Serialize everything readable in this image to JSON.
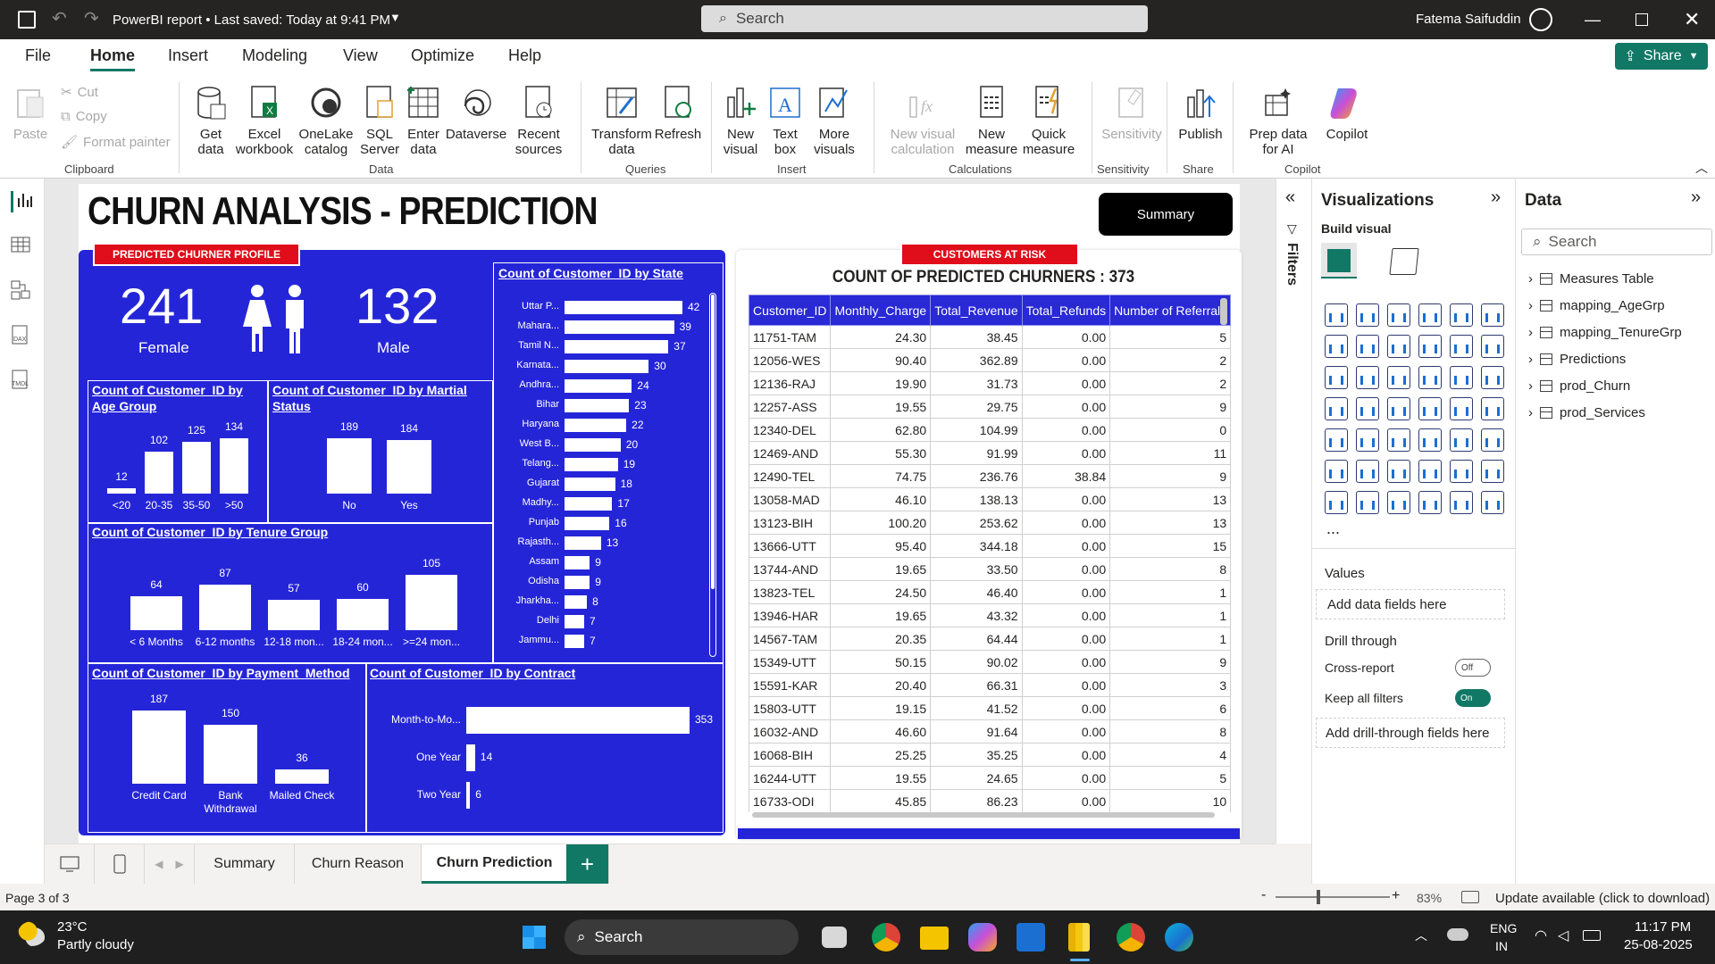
{
  "titlebar": {
    "title": "PowerBI report • Last saved: Today at 9:41 PM",
    "search": "Search",
    "user": "Fatema Saifuddin"
  },
  "menu": {
    "items": [
      "File",
      "Home",
      "Insert",
      "Modeling",
      "View",
      "Optimize",
      "Help"
    ],
    "active": "Home",
    "share": "Share"
  },
  "ribbon": {
    "clipboard": {
      "paste": "Paste",
      "cut": "Cut",
      "copy": "Copy",
      "format_painter": "Format painter",
      "group": "Clipboard"
    },
    "data": {
      "get_data": "Get data",
      "excel": "Excel workbook",
      "onelake": "OneLake catalog",
      "sql": "SQL Server",
      "enter": "Enter data",
      "dataverse": "Dataverse",
      "recent": "Recent sources",
      "group": "Data"
    },
    "queries": {
      "transform": "Transform data",
      "refresh": "Refresh",
      "group": "Queries"
    },
    "insert": {
      "new_visual": "New visual",
      "text_box": "Text box",
      "more_visuals": "More visuals",
      "group": "Insert"
    },
    "calculations": {
      "new_visual_calc": "New visual calculation",
      "new_measure": "New measure",
      "quick_measure": "Quick measure",
      "group": "Calculations"
    },
    "sensitivity": {
      "label": "Sensitivity",
      "group": "Sensitivity"
    },
    "share": {
      "publish": "Publish",
      "group": "Share"
    },
    "copilot": {
      "prep": "Prep data for AI",
      "copilot": "Copilot",
      "group": "Copilot"
    }
  },
  "report": {
    "title": "CHURN ANALYSIS - PREDICTION",
    "summary_button": "Summary",
    "profile_tag": "PREDICTED CHURNER PROFILE",
    "risk_tag": "CUSTOMERS AT RISK",
    "female_count": "241",
    "female_label": "Female",
    "male_count": "132",
    "male_label": "Male",
    "age_title": "Count of Customer_ID by Age Group",
    "marital_title": "Count of Customer_ID by Martial Status",
    "tenure_title": "Count of Customer_ID by Tenure Group",
    "payment_title": "Count of Customer_ID by Payment_Method",
    "contract_title": "Count of Customer_ID by Contract",
    "state_title": "Count of Customer_ID by State",
    "table_title": "COUNT OF PREDICTED CHURNERS : 373"
  },
  "chart_data": [
    {
      "type": "bar",
      "title": "Count of Customer_ID by Age Group",
      "categories": [
        "<20",
        "20-35",
        "35-50",
        ">50"
      ],
      "values": [
        12,
        102,
        125,
        134
      ]
    },
    {
      "type": "bar",
      "title": "Count of Customer_ID by Martial Status",
      "categories": [
        "No",
        "Yes"
      ],
      "values": [
        189,
        184
      ]
    },
    {
      "type": "bar",
      "title": "Count of Customer_ID by Tenure Group",
      "categories": [
        "< 6 Months",
        "6-12 months",
        "12-18 mon...",
        "18-24 mon...",
        ">=24 mon..."
      ],
      "values": [
        64,
        87,
        57,
        60,
        105
      ]
    },
    {
      "type": "bar",
      "title": "Count of Customer_ID by Payment_Method",
      "categories": [
        "Credit Card",
        "Bank Withdrawal",
        "Mailed Check"
      ],
      "values": [
        187,
        150,
        36
      ]
    },
    {
      "type": "bar",
      "orientation": "horizontal",
      "title": "Count of Customer_ID by Contract",
      "categories": [
        "Month-to-Mo...",
        "One Year",
        "Two Year"
      ],
      "values": [
        353,
        14,
        6
      ]
    },
    {
      "type": "bar",
      "orientation": "horizontal",
      "title": "Count of Customer_ID by State",
      "categories": [
        "Uttar P...",
        "Mahara...",
        "Tamil N...",
        "Karnata...",
        "Andhra...",
        "Bihar",
        "Haryana",
        "West B...",
        "Telang...",
        "Gujarat",
        "Madhy...",
        "Punjab",
        "Rajasth...",
        "Assam",
        "Odisha",
        "Jharkha...",
        "Delhi",
        "Jammu..."
      ],
      "values": [
        42,
        39,
        37,
        30,
        24,
        23,
        22,
        20,
        19,
        18,
        17,
        16,
        13,
        9,
        9,
        8,
        7,
        7
      ]
    }
  ],
  "table": {
    "columns": [
      "Customer_ID",
      "Monthly_Charge",
      "Total_Revenue",
      "Total_Refunds",
      "Number of Referrals"
    ],
    "rows": [
      [
        "11751-TAM",
        "24.30",
        "38.45",
        "0.00",
        "5"
      ],
      [
        "12056-WES",
        "90.40",
        "362.89",
        "0.00",
        "2"
      ],
      [
        "12136-RAJ",
        "19.90",
        "31.73",
        "0.00",
        "2"
      ],
      [
        "12257-ASS",
        "19.55",
        "29.75",
        "0.00",
        "9"
      ],
      [
        "12340-DEL",
        "62.80",
        "104.99",
        "0.00",
        "0"
      ],
      [
        "12469-AND",
        "55.30",
        "91.99",
        "0.00",
        "11"
      ],
      [
        "12490-TEL",
        "74.75",
        "236.76",
        "38.84",
        "9"
      ],
      [
        "13058-MAD",
        "46.10",
        "138.13",
        "0.00",
        "13"
      ],
      [
        "13123-BIH",
        "100.20",
        "253.62",
        "0.00",
        "13"
      ],
      [
        "13666-UTT",
        "95.40",
        "344.18",
        "0.00",
        "15"
      ],
      [
        "13744-AND",
        "19.65",
        "33.50",
        "0.00",
        "8"
      ],
      [
        "13823-TEL",
        "24.50",
        "46.40",
        "0.00",
        "1"
      ],
      [
        "13946-HAR",
        "19.65",
        "43.32",
        "0.00",
        "1"
      ],
      [
        "14567-TAM",
        "20.35",
        "64.44",
        "0.00",
        "1"
      ],
      [
        "15349-UTT",
        "50.15",
        "90.02",
        "0.00",
        "9"
      ],
      [
        "15591-KAR",
        "20.40",
        "66.31",
        "0.00",
        "3"
      ],
      [
        "15803-UTT",
        "19.15",
        "41.52",
        "0.00",
        "6"
      ],
      [
        "16032-AND",
        "46.60",
        "91.64",
        "0.00",
        "8"
      ],
      [
        "16068-BIH",
        "25.25",
        "35.25",
        "0.00",
        "4"
      ],
      [
        "16244-UTT",
        "19.55",
        "24.65",
        "0.00",
        "5"
      ],
      [
        "16733-ODI",
        "45.85",
        "86.23",
        "0.00",
        "10"
      ]
    ]
  },
  "filters": {
    "label": "Filters"
  },
  "visualizations": {
    "title": "Visualizations",
    "build": "Build visual",
    "values": "Values",
    "add_fields": "Add data fields here",
    "drill": "Drill through",
    "cross": "Cross-report",
    "cross_state": "Off",
    "keep": "Keep all filters",
    "keep_state": "On",
    "add_drill": "Add drill-through fields here",
    "more": "..."
  },
  "data_pane": {
    "title": "Data",
    "search": "Search",
    "tables": [
      "Measures Table",
      "mapping_AgeGrp",
      "mapping_TenureGrp",
      "Predictions",
      "prod_Churn",
      "prod_Services"
    ]
  },
  "tabs": {
    "items": [
      "Summary",
      "Churn Reason",
      "Churn Prediction"
    ],
    "active": "Churn Prediction",
    "add": "+"
  },
  "status": {
    "page": "Page 3 of 3",
    "zoom": "83%",
    "update": "Update available (click to download)"
  },
  "taskbar": {
    "temp": "23°C",
    "weather": "Partly cloudy",
    "search": "Search",
    "lang1": "ENG",
    "lang2": "IN",
    "time": "11:17 PM",
    "date": "25-08-2025"
  },
  "colors": {
    "panel": "#2525d8",
    "tag": "#e00d1a",
    "accent": "#117865"
  }
}
